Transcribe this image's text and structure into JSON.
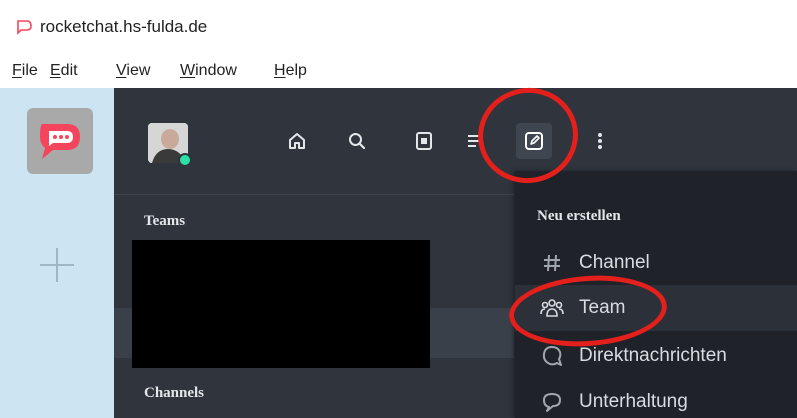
{
  "window": {
    "title": "rocketchat.hs-fulda.de",
    "icon": "rocket-chat-logo-icon"
  },
  "menubar": {
    "items": [
      {
        "mnemonic": "F",
        "rest": "ile"
      },
      {
        "mnemonic": "E",
        "rest": "dit"
      },
      {
        "mnemonic": "V",
        "rest": "iew"
      },
      {
        "mnemonic": "W",
        "rest": "indow"
      },
      {
        "mnemonic": "H",
        "rest": "elp"
      }
    ]
  },
  "server_rail": {
    "server_icon": "rocket-chat-logo-icon",
    "add_icon": "plus-icon"
  },
  "header": {
    "icons": [
      "home-icon",
      "search-icon",
      "directory-icon",
      "sort-icon",
      "create-new-icon",
      "kebab-menu-icon"
    ]
  },
  "sidebar": {
    "sections": {
      "teams": "Teams",
      "channels": "Channels"
    }
  },
  "create_menu": {
    "title": "Neu erstellen",
    "items": [
      {
        "label": "Channel",
        "icon": "hashtag-icon"
      },
      {
        "label": "Team",
        "icon": "team-icon"
      },
      {
        "label": "Direktnachrichten",
        "icon": "direct-message-icon"
      },
      {
        "label": "Unterhaltung",
        "icon": "discussion-icon"
      }
    ]
  },
  "colors": {
    "sidebar_bg": "#2f343d",
    "menu_bg": "#1f2329",
    "rail_bg": "#cde4f3",
    "annotation_red": "#e3201b",
    "brand_red": "#f5455c",
    "status_online": "#2de0a5"
  }
}
